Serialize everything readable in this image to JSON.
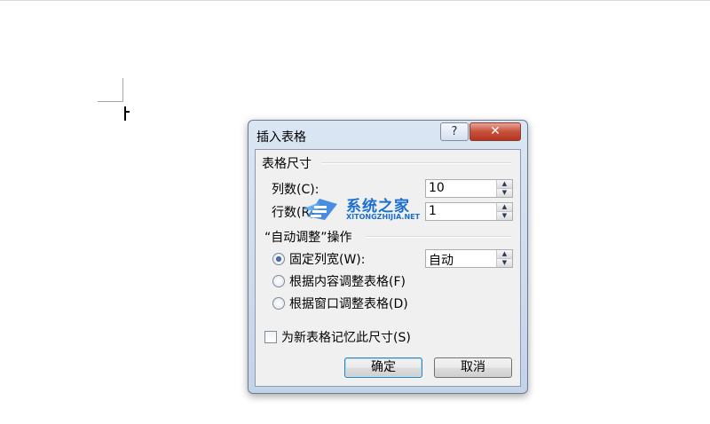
{
  "document": {
    "caret": "text-cursor"
  },
  "dialog": {
    "title": "插入表格",
    "help_button": "?",
    "close_button": "✕",
    "size_group": {
      "title": "表格尺寸",
      "columns_label": "列数(C):",
      "columns_value": "10",
      "rows_label": "行数(R):",
      "rows_value": "1"
    },
    "autofit_group": {
      "title": "“自动调整”操作",
      "fixed_width_label": "固定列宽(W):",
      "fixed_width_value": "自动",
      "fit_contents_label": "根据内容调整表格(F)",
      "fit_window_label": "根据窗口调整表格(D)",
      "selected_option": "fixed_width"
    },
    "remember_label": "为新表格记忆此尺寸(S)",
    "remember_checked": false,
    "ok_label": "确定",
    "cancel_label": "取消"
  },
  "watermark": {
    "text_cn": "系统之家",
    "text_en": "XITONGZHIJIA.NET"
  }
}
